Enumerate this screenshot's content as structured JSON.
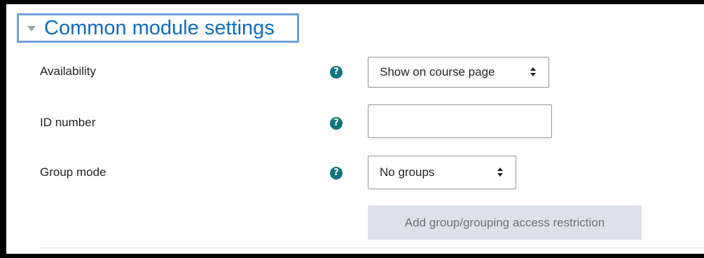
{
  "section": {
    "title": "Common module settings",
    "caret_icon": "caret-down-icon"
  },
  "fields": {
    "availability": {
      "label": "Availability",
      "help_icon": "question-circle-icon",
      "selected": "Show on course page"
    },
    "id_number": {
      "label": "ID number",
      "help_icon": "question-circle-icon",
      "value": "",
      "placeholder": ""
    },
    "group_mode": {
      "label": "Group mode",
      "help_icon": "question-circle-icon",
      "selected": "No groups"
    }
  },
  "buttons": {
    "add_restriction": "Add group/grouping access restriction"
  },
  "colors": {
    "accent": "#0f6cbf",
    "help_icon": "#10747f",
    "focus_outline": "#6f9fd6",
    "button_disabled_bg": "#dee2e6"
  }
}
